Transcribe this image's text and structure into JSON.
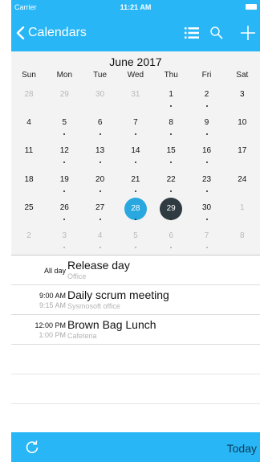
{
  "status_bar": {
    "carrier": "Carrier",
    "time": "11:21 AM"
  },
  "nav": {
    "back_label": "Calendars",
    "icons": [
      "chevron-left-icon",
      "list-icon",
      "search-icon",
      "plus-icon"
    ]
  },
  "calendar": {
    "month_title": "June 2017",
    "weekdays": [
      "Sun",
      "Mon",
      "Tue",
      "Wed",
      "Thu",
      "Fri",
      "Sat"
    ],
    "weeks": [
      [
        {
          "d": "28",
          "other": true,
          "dot": false
        },
        {
          "d": "29",
          "other": true,
          "dot": false
        },
        {
          "d": "30",
          "other": true,
          "dot": false
        },
        {
          "d": "31",
          "other": true,
          "dot": false
        },
        {
          "d": "1",
          "dot": true
        },
        {
          "d": "2",
          "dot": true
        },
        {
          "d": "3",
          "dot": false
        }
      ],
      [
        {
          "d": "4",
          "dot": false
        },
        {
          "d": "5",
          "dot": true
        },
        {
          "d": "6",
          "dot": true
        },
        {
          "d": "7",
          "dot": true
        },
        {
          "d": "8",
          "dot": true
        },
        {
          "d": "9",
          "dot": true
        },
        {
          "d": "10",
          "dot": false
        }
      ],
      [
        {
          "d": "11",
          "dot": false
        },
        {
          "d": "12",
          "dot": true
        },
        {
          "d": "13",
          "dot": true
        },
        {
          "d": "14",
          "dot": true
        },
        {
          "d": "15",
          "dot": true
        },
        {
          "d": "16",
          "dot": true
        },
        {
          "d": "17",
          "dot": false
        }
      ],
      [
        {
          "d": "18",
          "dot": false
        },
        {
          "d": "19",
          "dot": true
        },
        {
          "d": "20",
          "dot": true
        },
        {
          "d": "21",
          "dot": true
        },
        {
          "d": "22",
          "dot": true
        },
        {
          "d": "23",
          "dot": true
        },
        {
          "d": "24",
          "dot": false
        }
      ],
      [
        {
          "d": "25",
          "dot": false
        },
        {
          "d": "26",
          "dot": true
        },
        {
          "d": "27",
          "dot": true
        },
        {
          "d": "28",
          "dot": true,
          "state": "today"
        },
        {
          "d": "29",
          "dot": true,
          "state": "selected"
        },
        {
          "d": "30",
          "dot": true
        },
        {
          "d": "1",
          "other": true,
          "dot": false
        }
      ],
      [
        {
          "d": "2",
          "other": true,
          "dot": false
        },
        {
          "d": "3",
          "other": true,
          "dot": true
        },
        {
          "d": "4",
          "other": true,
          "dot": true
        },
        {
          "d": "5",
          "other": true,
          "dot": true
        },
        {
          "d": "6",
          "other": true,
          "dot": true
        },
        {
          "d": "7",
          "other": true,
          "dot": true
        },
        {
          "d": "8",
          "other": true,
          "dot": false
        }
      ]
    ],
    "today_color": "#29a8e0",
    "selected_color": "#2f3b41"
  },
  "events": [
    {
      "time_top": "All day",
      "time_bottom": "",
      "title": "Release day",
      "location": "Office"
    },
    {
      "time_top": "9:00 AM",
      "time_bottom": "9:15 AM",
      "title": "Daily scrum meeting",
      "location": "Sysmosoft office"
    },
    {
      "time_top": "12:00 PM",
      "time_bottom": "1:00 PM",
      "title": "Brown Bag Lunch",
      "location": "Cafeteria"
    }
  ],
  "bottom_bar": {
    "today_label": "Today"
  },
  "colors": {
    "accent": "#29b6f6"
  }
}
